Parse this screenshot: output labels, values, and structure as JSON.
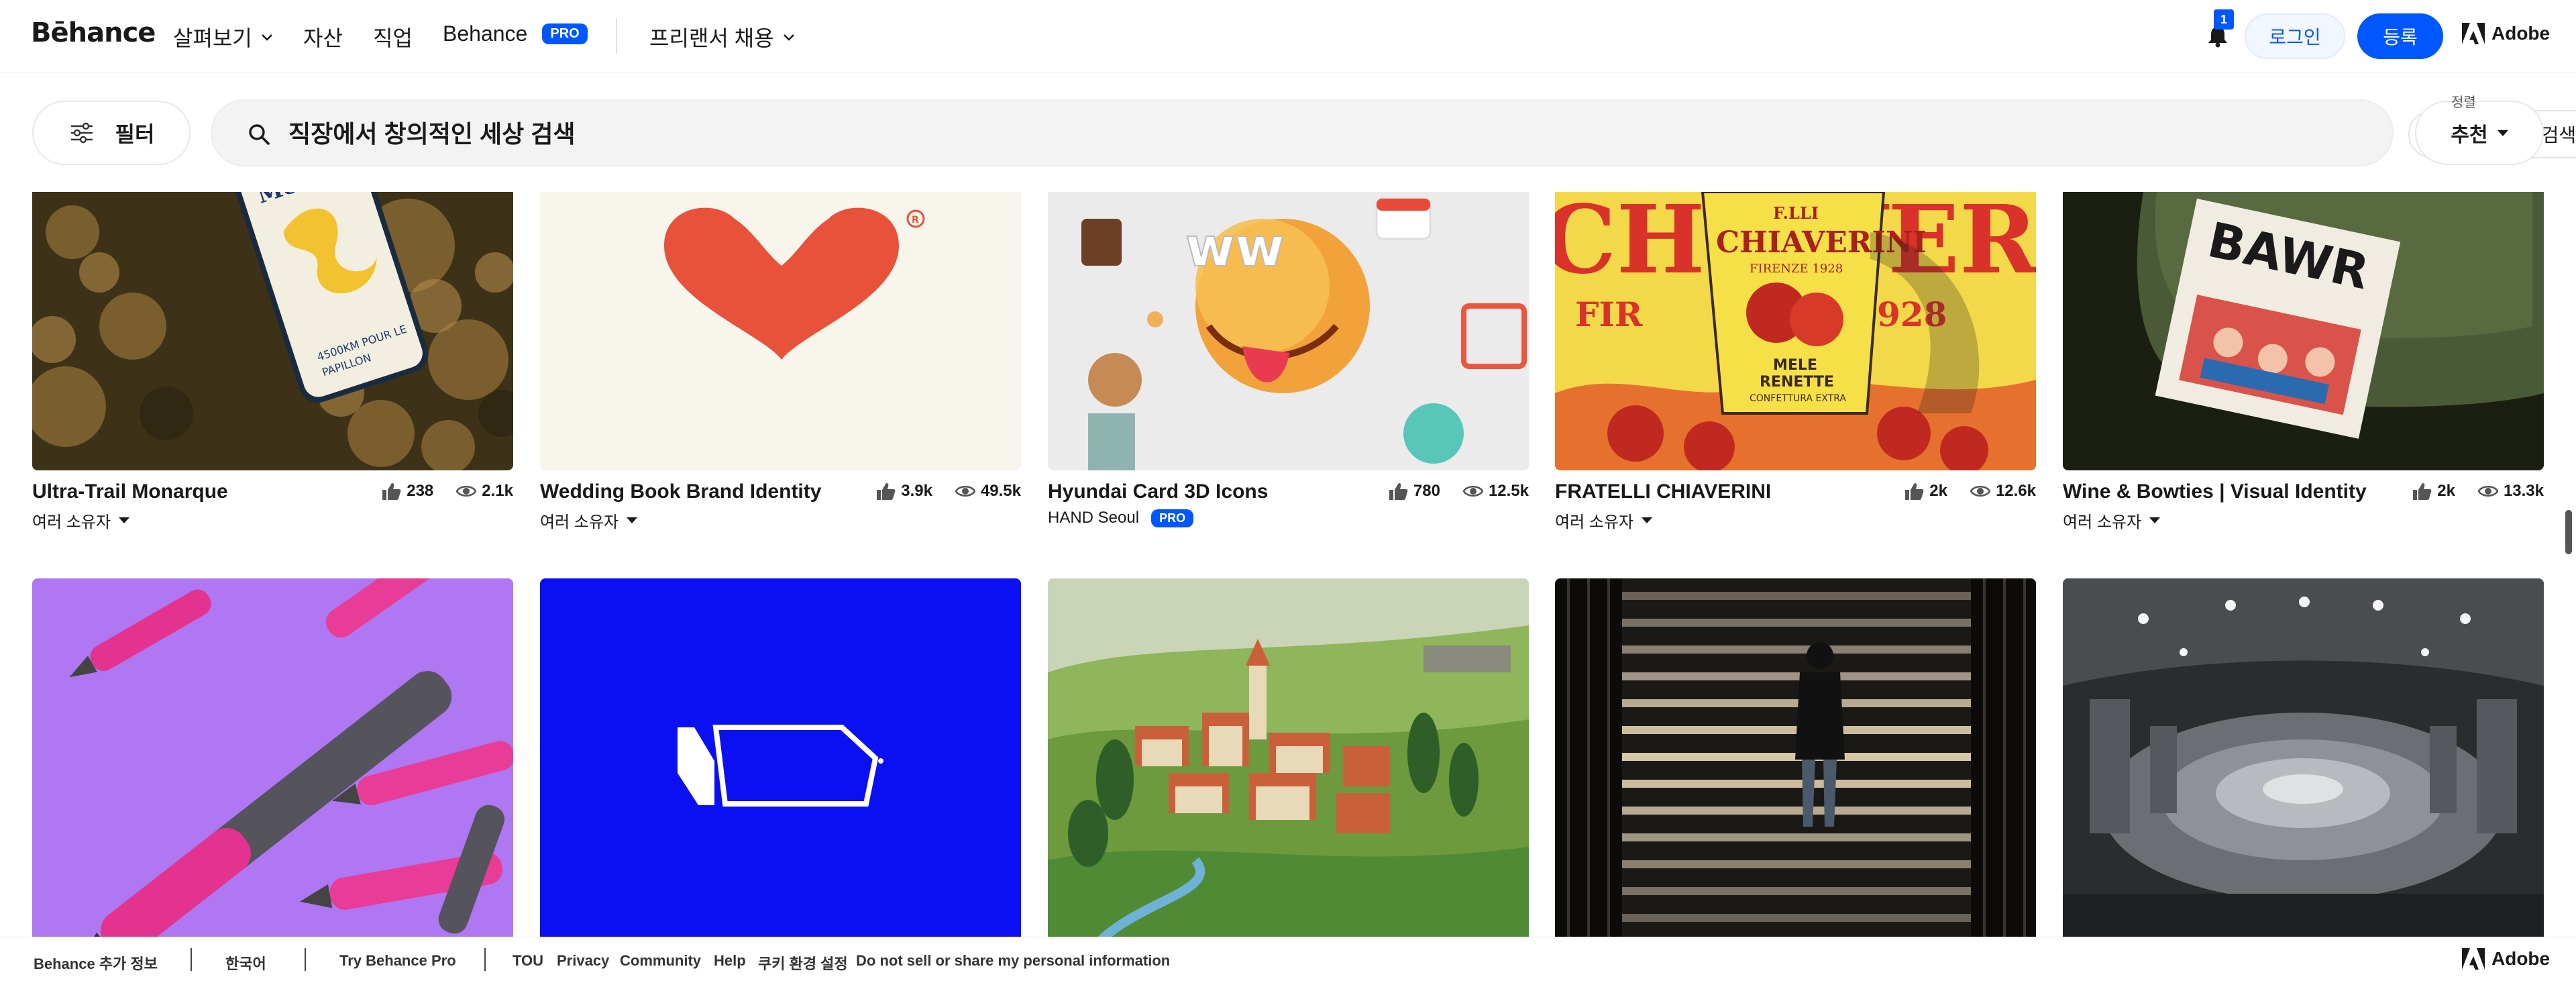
{
  "nav": {
    "logo": "Bēhance",
    "explore": "살펴보기",
    "assets": "자산",
    "jobs": "직업",
    "behance": "Behance",
    "pro": "PRO",
    "hire": "프리랜서 채용",
    "notification_count": "1",
    "login": "로그인",
    "register": "등록",
    "adobe": "Adobe"
  },
  "search": {
    "filter_label": "필터",
    "placeholder": "직장에서 창의적인 세상 검색",
    "image_search": "이미지로 검색",
    "sort_label": "정렬",
    "sort_value": "추천"
  },
  "projects": [
    {
      "title": "Ultra-Trail Monarque",
      "likes": "238",
      "views": "2.1k",
      "owner": "여러 소유자",
      "owner_caret": true,
      "pro": ""
    },
    {
      "title": "Wedding Book Brand Identity",
      "likes": "3.9k",
      "views": "49.5k",
      "owner": "여러 소유자",
      "owner_caret": true,
      "pro": ""
    },
    {
      "title": "Hyundai Card 3D Icons",
      "likes": "780",
      "views": "12.5k",
      "owner": "HAND Seoul",
      "owner_caret": false,
      "pro": "PRO"
    },
    {
      "title": "FRATELLI CHIAVERINI",
      "likes": "2k",
      "views": "12.6k",
      "owner": "여러 소유자",
      "owner_caret": true,
      "pro": ""
    },
    {
      "title": "Wine & Bowties | Visual Identity",
      "likes": "2k",
      "views": "13.3k",
      "owner": "여러 소유자",
      "owner_caret": true,
      "pro": ""
    }
  ],
  "thumb_text": {
    "monarque_text": "Monarque",
    "monarque_km": "4500KM POUR LE",
    "monarque_pap": "PAPILLON",
    "fratelli_brand": "F.LLI",
    "fratelli_name": "CHIAVERINI",
    "fratelli_firenze": "FIRENZE 1928",
    "fratelli_mele": "MELE",
    "fratelli_renette": "RENETTE",
    "fratelli_conf": "CONFETTURA EXTRA",
    "fratelli_bg": "CHIAVERINI",
    "fratelli_bg2": "FIR",
    "fratelli_bg3": "928",
    "wine_mag": "BAWR"
  },
  "footer": {
    "more": "Behance 추가 정보",
    "lang": "한국어",
    "try_pro": "Try Behance Pro",
    "tou": "TOU",
    "privacy": "Privacy",
    "community": "Community",
    "help": "Help",
    "cookie": "쿠키 환경 설정",
    "dnsmpi": "Do not sell or share my personal information",
    "adobe": "Adobe"
  },
  "colors": {
    "brand_blue": "#0057ff",
    "heart_red": "#e8523a",
    "blue_card": "#0a10f2",
    "purple_card": "#a46cf0"
  }
}
